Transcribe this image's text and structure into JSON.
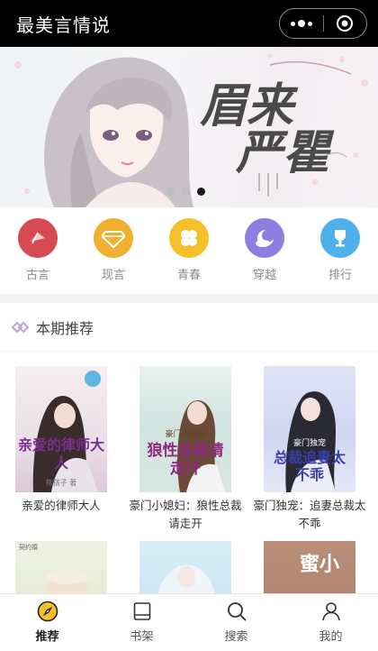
{
  "app": {
    "title": "最美言情说"
  },
  "banner": {
    "title_line1": "眉来",
    "title_line2": "严瞿",
    "dots": 3,
    "active_dot": 2
  },
  "categories": [
    {
      "label": "古言",
      "icon": "fan-icon",
      "color": "#d84a52"
    },
    {
      "label": "现言",
      "icon": "diamond-icon",
      "color": "#f0b030"
    },
    {
      "label": "青春",
      "icon": "clover-icon",
      "color": "#f5c02a"
    },
    {
      "label": "穿越",
      "icon": "moon-cloud-icon",
      "color": "#8d7fe0"
    },
    {
      "label": "排行",
      "icon": "trophy-icon",
      "color": "#4eb1ea"
    }
  ],
  "section": {
    "title": "本期推荐"
  },
  "books": [
    {
      "title": "亲爱的律师大人",
      "cover_text": "亲爱的律师大人",
      "author": "熊孩子 著",
      "badge": "悦读"
    },
    {
      "title": "豪门小媳妇：狼性总裁请走开",
      "cover_text": "狼性总裁请走开",
      "cover_tag": "豪门小媳妇"
    },
    {
      "title": "豪门独宠：追妻总裁太不乖",
      "cover_text": "总裁追妻太不乖",
      "cover_tag": "豪门独宠"
    },
    {
      "title": "",
      "cover_tag": "契约婚"
    },
    {
      "title": ""
    },
    {
      "title": "",
      "cover_text": "蜜小"
    }
  ],
  "tabs": [
    {
      "label": "推荐",
      "icon": "compass-icon",
      "active": true
    },
    {
      "label": "书架",
      "icon": "bookshelf-icon",
      "active": false
    },
    {
      "label": "搜索",
      "icon": "search-icon",
      "active": false
    },
    {
      "label": "我的",
      "icon": "user-icon",
      "active": false
    }
  ]
}
